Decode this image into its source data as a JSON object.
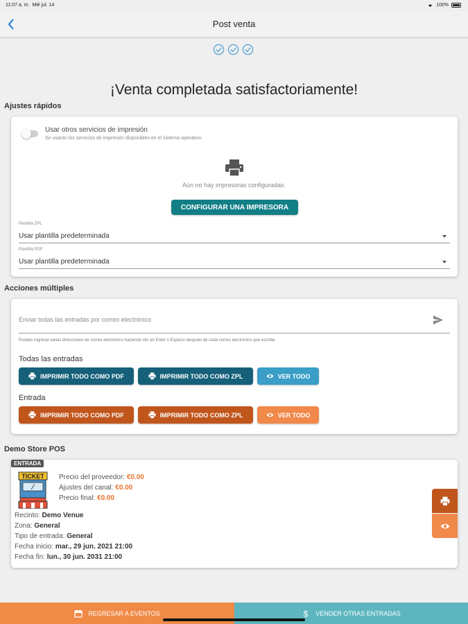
{
  "status_bar": {
    "time": "11:07 a. m.",
    "date": "Mié jul. 14",
    "battery": "100%"
  },
  "header": {
    "title": "Post venta"
  },
  "main": {
    "title": "¡Venta completada satisfactoriamente!"
  },
  "quick_settings": {
    "section_title": "Ajustes rápidos",
    "toggle_label": "Usar otros servicios de impresión",
    "toggle_sub": "Se usarán los servicios de impresión disponibles en el sistema operativo.",
    "no_printers": "Aún no hay impresoras configuradas.",
    "config_button": "CONFIGURAR UNA IMPRESORA",
    "zpl_label": "Plantilla ZPL",
    "zpl_value": "Usar plantilla predeterminada",
    "pdf_label": "Plantilla PDF",
    "pdf_value": "Usar plantilla predeterminada"
  },
  "bulk_actions": {
    "section_title": "Acciones múltiples",
    "email_placeholder": "Enviar todas las entradas por correo electrónico",
    "email_help": "Puedes ingresar varias direcciones de correo electrónico haciendo clic en Enter o Espacio después de cada correo electrónico que escriba",
    "all_title": "Todas las entradas",
    "entry_title": "Entrada",
    "print_pdf": "IMPRIMIR TODO COMO PDF",
    "print_zpl": "IMPRIMIR TODO COMO ZPL",
    "view_all": "VER TODO"
  },
  "store": {
    "section_title": "Demo Store POS",
    "badge": "ENTRADA",
    "ticket_word": "TICKET",
    "provider_price_label": "Precio del proveedor:",
    "provider_price": "€0.00",
    "channel_adj_label": "Ajustes del canal:",
    "channel_adj": "€0.00",
    "final_price_label": "Precio final:",
    "final_price": "€0.00",
    "venue_label": "Recinto:",
    "venue": "Demo Venue",
    "zone_label": "Zona:",
    "zone": "General",
    "ticket_type_label": "Tipo de entrada:",
    "ticket_type": "General",
    "start_label": "Fecha inicio:",
    "start": "mar., 29 jun. 2021 21:00",
    "end_label": "Fecha fin:",
    "end": "lun., 30 jun. 2031 21:00"
  },
  "bottom_bar": {
    "back_events": "REGRESAR A EVENTOS",
    "sell_more": "VENDER OTRAS ENTRADAS"
  },
  "colors": {
    "teal": "#16607a",
    "teal_light": "#3a9ec6",
    "orange": "#c1561d",
    "orange_light": "#f0894a",
    "config_button": "#127f86",
    "bottom_left": "#f08a47",
    "bottom_right": "#5db6bf",
    "price_accent": "#e8742c",
    "back_arrow": "#1a7ad6"
  },
  "icons": {
    "back": "chevron-left-icon",
    "steps": "check-circle-icon",
    "printer": "printer-icon",
    "send": "send-icon",
    "eye": "eye-icon",
    "calendar": "calendar-icon",
    "dollar": "dollar-icon"
  }
}
